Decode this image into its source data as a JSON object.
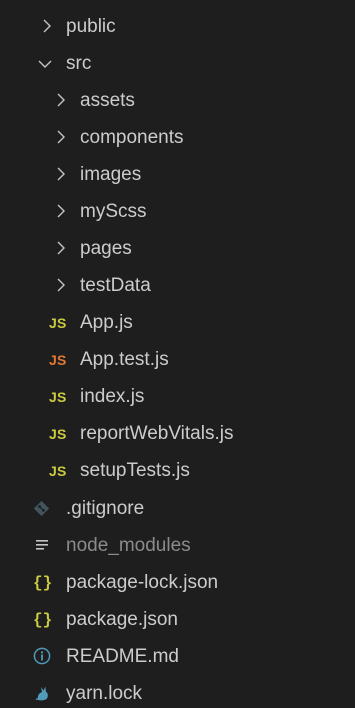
{
  "explorer": {
    "items": [
      {
        "label": "public",
        "type": "folder",
        "state": "collapsed"
      },
      {
        "label": "src",
        "type": "folder",
        "state": "expanded"
      },
      {
        "label": "assets",
        "type": "folder",
        "state": "collapsed"
      },
      {
        "label": "components",
        "type": "folder",
        "state": "collapsed"
      },
      {
        "label": "images",
        "type": "folder",
        "state": "collapsed"
      },
      {
        "label": "myScss",
        "type": "folder",
        "state": "collapsed"
      },
      {
        "label": "pages",
        "type": "folder",
        "state": "collapsed"
      },
      {
        "label": "testData",
        "type": "folder",
        "state": "collapsed"
      },
      {
        "label": "App.js",
        "type": "js",
        "icon_text": "JS"
      },
      {
        "label": "App.test.js",
        "type": "test-js",
        "icon_text": "JS"
      },
      {
        "label": "index.js",
        "type": "js",
        "icon_text": "JS"
      },
      {
        "label": "reportWebVitals.js",
        "type": "js",
        "icon_text": "JS"
      },
      {
        "label": "setupTests.js",
        "type": "js",
        "icon_text": "JS"
      },
      {
        "label": ".gitignore",
        "type": "git",
        "icon": "git-icon"
      },
      {
        "label": "node_modules",
        "type": "ignored",
        "icon": "lines-icon"
      },
      {
        "label": "package-lock.json",
        "type": "json",
        "icon_text": "{}"
      },
      {
        "label": "package.json",
        "type": "json",
        "icon_text": "{}"
      },
      {
        "label": "README.md",
        "type": "info",
        "icon": "info-icon"
      },
      {
        "label": "yarn.lock",
        "type": "yarn",
        "icon": "yarn-icon"
      }
    ]
  },
  "colors": {
    "background": "#1e1e1e",
    "text": "#cccccc",
    "text_dim": "#8b8b8b",
    "chevron": "#c5c5c5",
    "js_yellow": "#cbcb41",
    "test_js_orange": "#e37933",
    "json_yellow": "#cbcb41",
    "info_blue": "#519aba",
    "git_gray": "#41535b",
    "yarn_blue": "#519aba"
  }
}
